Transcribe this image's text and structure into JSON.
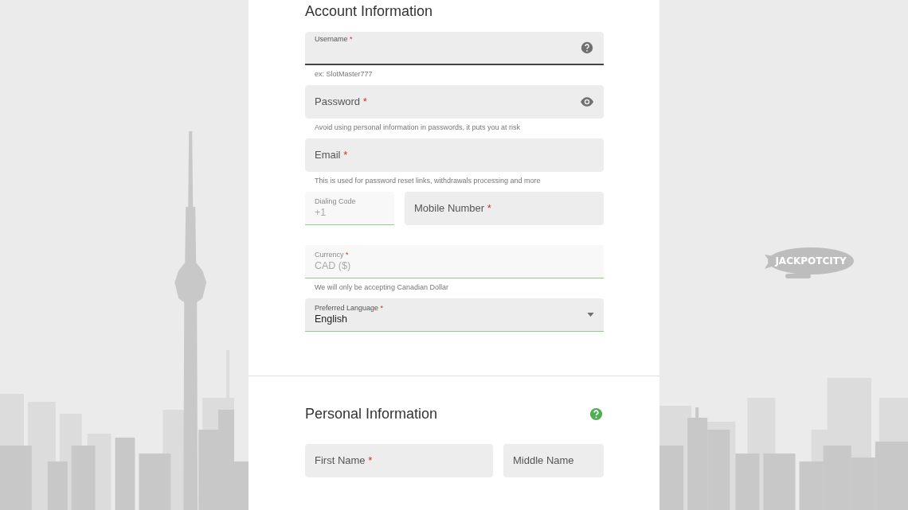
{
  "blimp": {
    "logo": "JACKPOTCITY"
  },
  "sections": [
    {
      "title": "Account Information",
      "help": false,
      "rows": [
        [
          {
            "kind": "help",
            "label": "Username",
            "required_mark": "*",
            "focused": true,
            "valid": false,
            "disabled": false,
            "hint": "ex: SlotMaster777"
          }
        ],
        [
          {
            "kind": "password",
            "label": "Password",
            "required_mark": "*",
            "focused": false,
            "valid": false,
            "disabled": false,
            "hint": "Avoid using personal information in passwords, it puts you at risk"
          }
        ],
        [
          {
            "kind": "text",
            "label": "Email",
            "required_mark": "*",
            "focused": false,
            "valid": false,
            "disabled": false,
            "hint": "This is used for password reset links, withdrawals processing and more"
          }
        ],
        [
          {
            "kind": "text",
            "label": "Dialing Code",
            "focused": false,
            "valid": true,
            "disabled": true,
            "value": "+1"
          },
          {
            "kind": "text",
            "label": "Mobile Number",
            "required_mark": "*",
            "focused": false,
            "valid": false,
            "disabled": false
          }
        ],
        [
          {
            "kind": "text",
            "label": "Currency",
            "required_mark": "*",
            "focused": false,
            "valid": true,
            "disabled": true,
            "value": "CAD ($)",
            "hint": "We will only be accepting Canadian Dollar"
          }
        ],
        [
          {
            "kind": "select",
            "label": "Preferred Language",
            "required_mark": "*",
            "focused": false,
            "valid": true,
            "disabled": false,
            "value": "English"
          }
        ]
      ]
    },
    {
      "title": "Personal Information",
      "help": true,
      "rows": [
        [
          {
            "kind": "text",
            "label": "First Name",
            "required_mark": "*",
            "focused": false,
            "valid": false,
            "disabled": false
          },
          {
            "kind": "text",
            "label": "Middle Name",
            "focused": false,
            "valid": false,
            "disabled": false
          }
        ]
      ]
    }
  ]
}
